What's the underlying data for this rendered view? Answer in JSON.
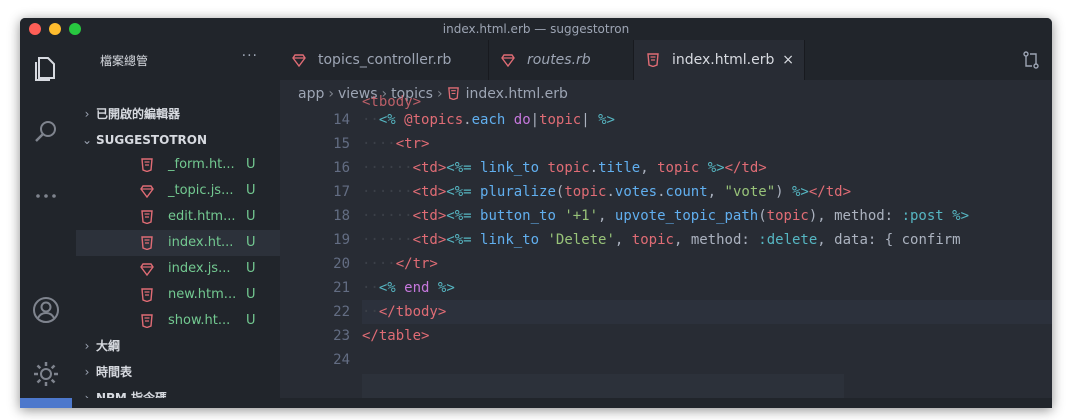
{
  "window": {
    "title": "index.html.erb — suggestotron"
  },
  "sidebar": {
    "header": "檔案總管",
    "more": "···",
    "sections": {
      "open_editors": "已開啟的編輯器",
      "project": "SUGGESTOTRON",
      "outline": "大綱",
      "timeline": "時間表",
      "npm": "NPM 指令碼"
    },
    "files": [
      {
        "name": "_form.ht...",
        "status": "U",
        "type": "html"
      },
      {
        "name": "_topic.js...",
        "status": "U",
        "type": "ruby"
      },
      {
        "name": "edit.htm...",
        "status": "U",
        "type": "html"
      },
      {
        "name": "index.ht...",
        "status": "U",
        "type": "html",
        "active": true
      },
      {
        "name": "index.js...",
        "status": "U",
        "type": "ruby"
      },
      {
        "name": "new.htm...",
        "status": "U",
        "type": "html"
      },
      {
        "name": "show.ht...",
        "status": "U",
        "type": "html"
      }
    ]
  },
  "tabs": [
    {
      "label": "topics_controller.rb",
      "type": "ruby",
      "active": false,
      "italic": false
    },
    {
      "label": "routes.rb",
      "type": "ruby",
      "active": false,
      "italic": true
    },
    {
      "label": "index.html.erb",
      "type": "html",
      "active": true,
      "italic": false
    }
  ],
  "tab_close": "×",
  "breadcrumb": {
    "parts": [
      "app",
      "views",
      "topics"
    ],
    "file": "index.html.erb",
    "sep": "›"
  },
  "editor": {
    "partial_top": "<tbody>",
    "line_numbers": [
      "14",
      "15",
      "16",
      "17",
      "18",
      "19",
      "20",
      "21",
      "22",
      "23",
      "24"
    ]
  },
  "colors": {
    "accent": "#4d78cc",
    "untracked": "#73c991",
    "tag": "#e06c75",
    "string": "#98c379",
    "function": "#61afef",
    "keyword": "#c678dd"
  }
}
